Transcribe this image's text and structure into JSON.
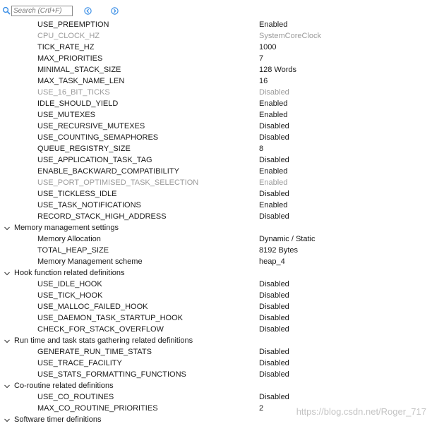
{
  "search": {
    "placeholder": "Search (Crtl+F)"
  },
  "toolbar": {
    "icons": [
      "search-icon",
      "previous-icon",
      "next-icon"
    ],
    "accent_color": "#3a8ee6"
  },
  "groups": [
    {
      "title": "",
      "rows": [
        {
          "name": "USE_PREEMPTION",
          "value": "Enabled",
          "disabled": false
        },
        {
          "name": "CPU_CLOCK_HZ",
          "value": "SystemCoreClock",
          "disabled": true
        },
        {
          "name": "TICK_RATE_HZ",
          "value": "1000",
          "disabled": false
        },
        {
          "name": "MAX_PRIORITIES",
          "value": "7",
          "disabled": false
        },
        {
          "name": "MINIMAL_STACK_SIZE",
          "value": "128 Words",
          "disabled": false
        },
        {
          "name": "MAX_TASK_NAME_LEN",
          "value": "16",
          "disabled": false
        },
        {
          "name": "USE_16_BIT_TICKS",
          "value": "Disabled",
          "disabled": true
        },
        {
          "name": "IDLE_SHOULD_YIELD",
          "value": "Enabled",
          "disabled": false
        },
        {
          "name": "USE_MUTEXES",
          "value": "Enabled",
          "disabled": false
        },
        {
          "name": "USE_RECURSIVE_MUTEXES",
          "value": "Disabled",
          "disabled": false
        },
        {
          "name": "USE_COUNTING_SEMAPHORES",
          "value": "Disabled",
          "disabled": false
        },
        {
          "name": "QUEUE_REGISTRY_SIZE",
          "value": "8",
          "disabled": false
        },
        {
          "name": "USE_APPLICATION_TASK_TAG",
          "value": "Disabled",
          "disabled": false
        },
        {
          "name": "ENABLE_BACKWARD_COMPATIBILITY",
          "value": "Enabled",
          "disabled": false
        },
        {
          "name": "USE_PORT_OPTIMISED_TASK_SELECTION",
          "value": "Enabled",
          "disabled": true
        },
        {
          "name": "USE_TICKLESS_IDLE",
          "value": "Disabled",
          "disabled": false
        },
        {
          "name": "USE_TASK_NOTIFICATIONS",
          "value": "Enabled",
          "disabled": false
        },
        {
          "name": "RECORD_STACK_HIGH_ADDRESS",
          "value": "Disabled",
          "disabled": false
        }
      ]
    },
    {
      "title": "Memory management settings",
      "rows": [
        {
          "name": "Memory Allocation",
          "value": "Dynamic / Static",
          "disabled": false
        },
        {
          "name": "TOTAL_HEAP_SIZE",
          "value": "8192 Bytes",
          "disabled": false
        },
        {
          "name": "Memory Management scheme",
          "value": "heap_4",
          "disabled": false
        }
      ]
    },
    {
      "title": "Hook function related definitions",
      "rows": [
        {
          "name": "USE_IDLE_HOOK",
          "value": "Disabled",
          "disabled": false
        },
        {
          "name": "USE_TICK_HOOK",
          "value": "Disabled",
          "disabled": false
        },
        {
          "name": "USE_MALLOC_FAILED_HOOK",
          "value": "Disabled",
          "disabled": false
        },
        {
          "name": "USE_DAEMON_TASK_STARTUP_HOOK",
          "value": "Disabled",
          "disabled": false
        },
        {
          "name": "CHECK_FOR_STACK_OVERFLOW",
          "value": "Disabled",
          "disabled": false
        }
      ]
    },
    {
      "title": "Run time and task stats gathering related definitions",
      "rows": [
        {
          "name": "GENERATE_RUN_TIME_STATS",
          "value": "Disabled",
          "disabled": false
        },
        {
          "name": "USE_TRACE_FACILITY",
          "value": "Disabled",
          "disabled": false
        },
        {
          "name": "USE_STATS_FORMATTING_FUNCTIONS",
          "value": "Disabled",
          "disabled": false
        }
      ]
    },
    {
      "title": "Co-routine related definitions",
      "rows": [
        {
          "name": "USE_CO_ROUTINES",
          "value": "Disabled",
          "disabled": false
        },
        {
          "name": "MAX_CO_ROUTINE_PRIORITIES",
          "value": "2",
          "disabled": false
        }
      ]
    },
    {
      "title": "Software timer definitions",
      "rows": []
    }
  ],
  "watermark": "https://blog.csdn.net/Roger_717"
}
